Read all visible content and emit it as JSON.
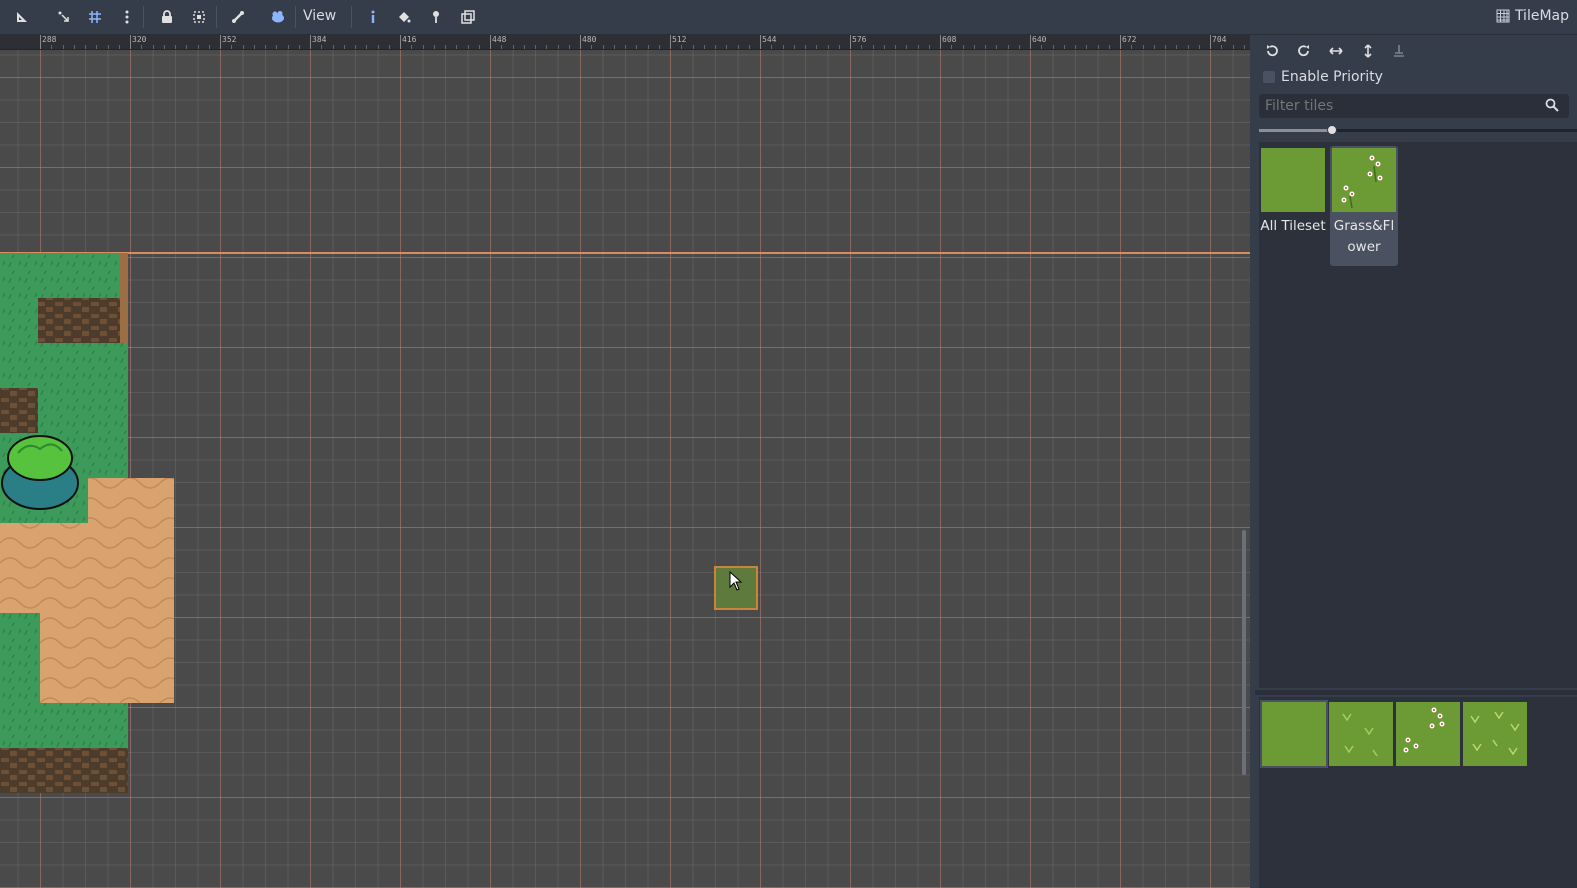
{
  "toolbar": {
    "view_label": "View",
    "tilemap_label": "TileMap",
    "icons": [
      "select-icon",
      "move-icon",
      "grid-snap-icon",
      "more-icon",
      "lock-icon",
      "group-icon",
      "bone-icon",
      "camera-icon",
      "info-icon",
      "bucket-icon",
      "pin-icon",
      "duplicate-icon"
    ]
  },
  "ruler": {
    "labels": [
      "288",
      "320",
      "352",
      "384",
      "416",
      "448",
      "480",
      "512",
      "544",
      "576",
      "608",
      "640",
      "672",
      "704"
    ]
  },
  "panel": {
    "buttons": [
      "rotate-left-icon",
      "rotate-right-icon",
      "flip-horizontal-icon",
      "flip-vertical-icon",
      "clear-transform-icon"
    ],
    "enable_priority_label": "Enable Priority",
    "enable_priority_checked": false,
    "filter_placeholder": "Filter tiles",
    "zoom_level": 0.23,
    "tilesets": [
      {
        "label": "All Tileset",
        "selected": false
      },
      {
        "label": "Grass&Flower",
        "selected": true
      }
    ],
    "tiles": [
      "plain-grass",
      "grass-sprouts",
      "grass-flowers",
      "grass-weeds"
    ],
    "selected_tile": 0
  },
  "colors": {
    "background": "#363d4a",
    "grass": "#6c9a34",
    "axis": "#d98c5f",
    "selection_border": "#c9843d"
  }
}
